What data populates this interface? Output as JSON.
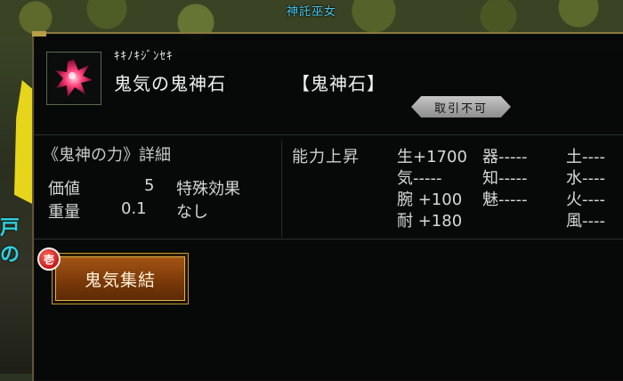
{
  "world": {
    "npc_name": "神託巫女",
    "side_text": "戸の"
  },
  "item": {
    "reading": "ｷｷﾉｷｼﾞﾝｾｷ",
    "name": "鬼気の鬼神石",
    "category": "【鬼神石】",
    "trade_status": "取引不可",
    "icon": "red-crystal-icon"
  },
  "details": {
    "title": "《鬼神の力》詳細",
    "value_label": "価値",
    "value": "5",
    "weight_label": "重量",
    "weight": "0.1",
    "special_label": "特殊効果",
    "special_value": "なし"
  },
  "ability": {
    "label": "能力上昇",
    "col1": [
      "生+1700",
      "気-----",
      "腕 +100",
      "耐 +180"
    ],
    "col2": [
      "器-----",
      "知-----",
      "魅-----"
    ],
    "col3": [
      "土----",
      "水----",
      "火----",
      "風----"
    ]
  },
  "skill": {
    "badge": "壱",
    "label": "鬼気集結"
  },
  "colors": {
    "panel_bg": "#040606",
    "npc_name": "#45c9ec",
    "button_orange": "#a45414",
    "badge_red": "#c81818"
  }
}
